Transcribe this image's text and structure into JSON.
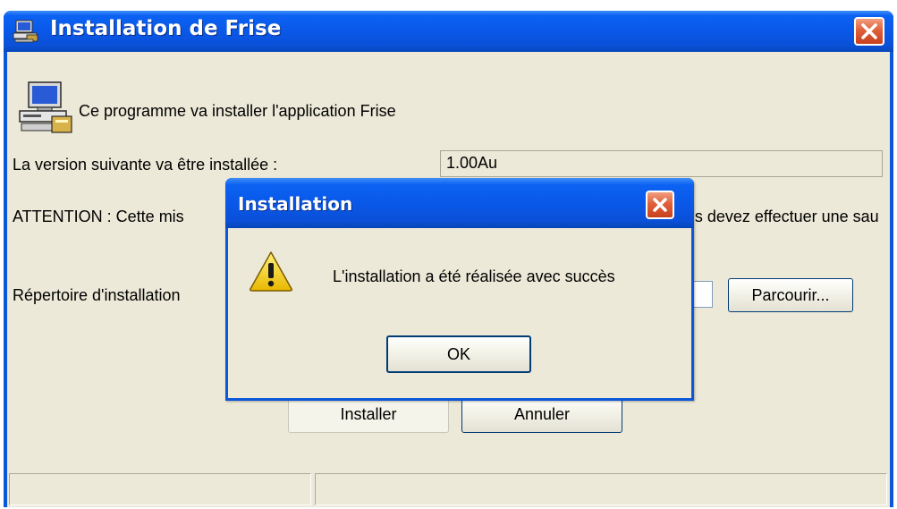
{
  "window": {
    "title": "Installation de Frise",
    "title_icon": "computer-install-icon",
    "close_icon": "close-icon"
  },
  "main": {
    "app_icon": "computer-install-icon",
    "intro": "Ce programme va installer l'application Frise",
    "version_label": "La version suivante va être installée :",
    "version_value": "1.00Au",
    "warning_text": "ATTENTION : Cette mis                                                                                     ienne version, vous devez effectuer une sau",
    "directory_label": "Répertoire d'installation",
    "directory_value": "",
    "browse_label": "Parcourir...",
    "install_label": "Installer",
    "cancel_label": "Annuler"
  },
  "statusbar": {
    "pane1": "",
    "pane2": ""
  },
  "dialog": {
    "title": "Installation",
    "message": "L'installation a été réalisée avec succès",
    "icon": "warning-icon",
    "ok_label": "OK"
  },
  "colors": {
    "titlebar_blue": "#0a58e8",
    "client_bg": "#ece9d8",
    "close_red": "#e0603a"
  }
}
